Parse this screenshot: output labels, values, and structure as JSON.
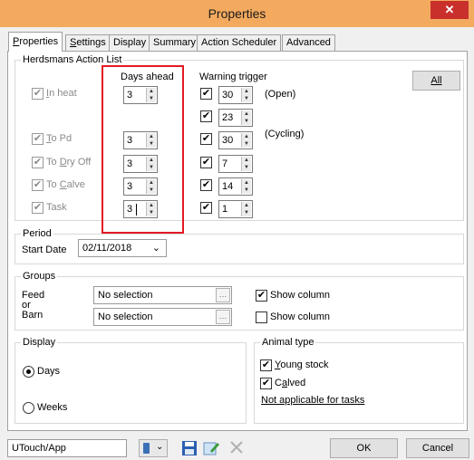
{
  "window": {
    "title": "Properties",
    "close_glyph": "✕"
  },
  "tabs": [
    {
      "label": "Properties",
      "underline": "P",
      "rest": "roperties"
    },
    {
      "label": "Settings",
      "underline": "S",
      "rest": "ettings"
    },
    {
      "label": "Display"
    },
    {
      "label": "Summary"
    },
    {
      "label": "Action Scheduler"
    },
    {
      "label": "Advanced"
    }
  ],
  "herdsmans": {
    "legend": "Herdsmans Action List",
    "days_ahead_header": "Days ahead",
    "warning_trigger_header": "Warning trigger",
    "all_button": "All",
    "rows": [
      {
        "ul": "I",
        "rest": "n heat",
        "checked": true,
        "days": "3",
        "warn_checked": true,
        "warn": "30",
        "note": "(Open)"
      },
      {
        "warn_checked": true,
        "warn": "23"
      },
      {
        "pre": "",
        "ul": "T",
        "rest": "o Pd",
        "checked": true,
        "days": "3",
        "warn_checked": true,
        "warn": "30",
        "note": "(Cycling)"
      },
      {
        "pre": "To ",
        "ul": "D",
        "rest": "ry Off",
        "checked": true,
        "days": "3",
        "warn_checked": true,
        "warn": "7"
      },
      {
        "pre": "To ",
        "ul": "C",
        "rest": "alve",
        "checked": true,
        "days": "3",
        "warn_checked": true,
        "warn": "14"
      },
      {
        "pre": "Task",
        "checked": true,
        "days": "3",
        "warn_checked": true,
        "warn": "1"
      }
    ]
  },
  "period": {
    "legend": "Period",
    "start_label": "Start Date",
    "start_value": "02/11/2018"
  },
  "groups": {
    "legend": "Groups",
    "feed_label": "Feed",
    "or_label": "or",
    "barn_label": "Barn",
    "feed_value": "No selection",
    "barn_value": "No selection",
    "show_column": "Show column",
    "feed_show_checked": true,
    "barn_show_checked": false
  },
  "display": {
    "legend": "Display",
    "days": "Days",
    "weeks": "Weeks",
    "selected": "Days"
  },
  "animal_type": {
    "legend": "Animal type",
    "young_ul": "Y",
    "young_rest": "oung stock",
    "calved_pre": "C",
    "calved_ul": "a",
    "calved_rest": "lved",
    "young_checked": true,
    "calved_checked": true,
    "note": "Not applicable for tasks"
  },
  "bottom": {
    "app_value": "UTouch/App",
    "ok": "OK",
    "cancel": "Cancel"
  },
  "colors": {
    "title_bar": "#f3aa5f",
    "highlight": "#e31b23"
  },
  "icons": [
    "phone-icon",
    "save-icon",
    "edit-icon",
    "delete-icon"
  ]
}
